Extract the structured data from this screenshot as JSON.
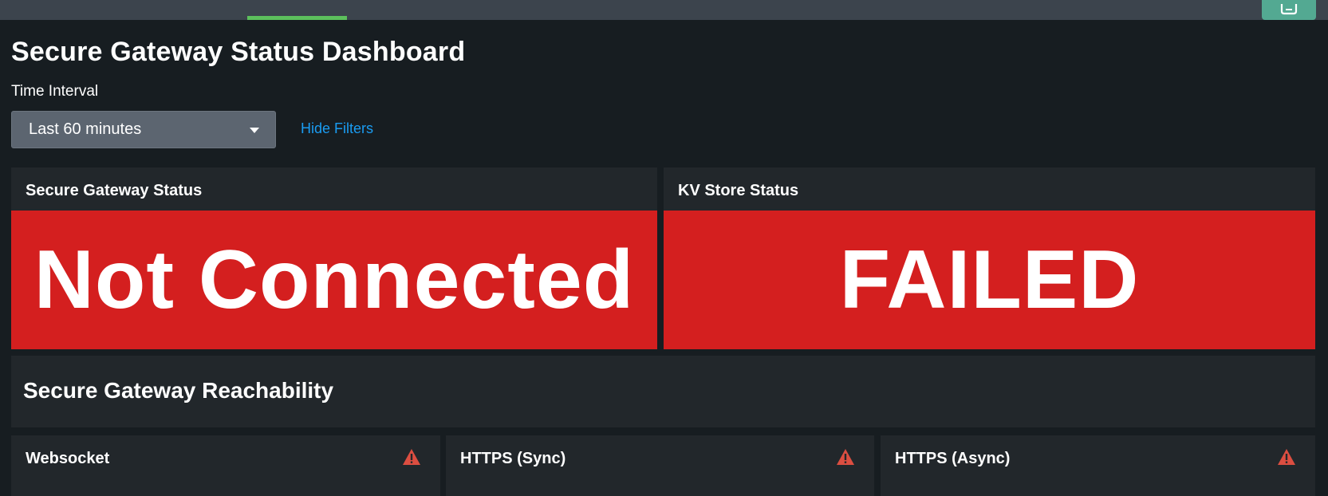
{
  "topbar": {
    "active_tab_color": "#5cc05c",
    "action_icon": "dashboard-edit-icon"
  },
  "dashboard": {
    "title": "Secure Gateway Status Dashboard"
  },
  "filters": {
    "time_interval_label": "Time Interval",
    "time_interval_value": "Last 60 minutes",
    "hide_filters_label": "Hide Filters"
  },
  "panels": {
    "gateway_status": {
      "title": "Secure Gateway Status",
      "value": "Not Connected",
      "color": "#d41f1f"
    },
    "kvstore_status": {
      "title": "KV Store Status",
      "value": "FAILED",
      "color": "#d41f1f"
    }
  },
  "reachability": {
    "title": "Secure Gateway Reachability",
    "items": [
      {
        "label": "Websocket",
        "icon": "warning-icon"
      },
      {
        "label": "HTTPS (Sync)",
        "icon": "warning-icon"
      },
      {
        "label": "HTTPS (Async)",
        "icon": "warning-icon"
      }
    ],
    "warning_color": "#dc4e41"
  }
}
